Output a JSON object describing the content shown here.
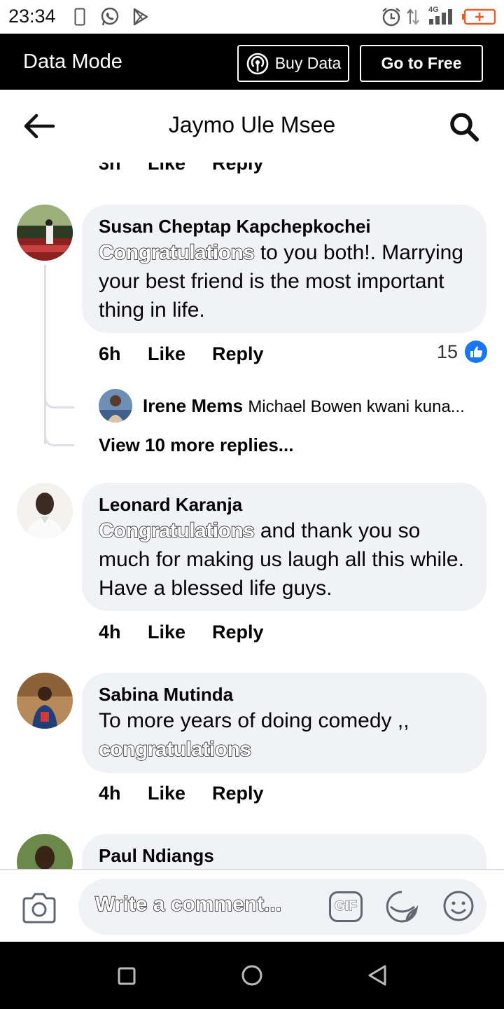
{
  "status_bar": {
    "time": "23:34",
    "network_label": "4G",
    "icons": [
      "sim-icon",
      "whatsapp-icon",
      "play-store-icon",
      "alarm-icon",
      "data-arrows-icon",
      "signal-icon",
      "battery-icon"
    ]
  },
  "data_mode_bar": {
    "title": "Data Mode",
    "buy_data_label": "Buy Data",
    "go_free_label": "Go to Free"
  },
  "header": {
    "title": "Jaymo Ule Msee"
  },
  "top_partial_actions": {
    "time": "3h",
    "like": "Like",
    "reply": "Reply"
  },
  "comments": [
    {
      "author": "Susan Cheptap Kapchepkochei",
      "text_highlight": "Congratulations",
      "text_rest": " to you both!. Marrying your best friend is the most important thing in life.",
      "time": "6h",
      "like": "Like",
      "reply": "Reply",
      "reactions": "15",
      "reply_preview": {
        "author": "Irene Mems",
        "text": "Michael Bowen kwani kuna..."
      },
      "more_replies": "View 10 more replies..."
    },
    {
      "author": "Leonard Karanja",
      "text_highlight": "Congratulations",
      "text_rest": " and thank you so much for making us laugh all this while. Have a blessed life guys.",
      "time": "4h",
      "like": "Like",
      "reply": "Reply"
    },
    {
      "author": "Sabina Mutinda",
      "text_plain": "To more years of doing comedy ,,",
      "text_highlight": "congratulations",
      "time": "4h",
      "like": "Like",
      "reply": "Reply"
    },
    {
      "author": "Paul Ndiangs"
    }
  ],
  "composer": {
    "placeholder": "Write a comment...",
    "gif_label": "GIF"
  },
  "colors": {
    "bubble": "#f0f2f5",
    "like_blue": "#1877f2",
    "data_bar": "#000000"
  }
}
